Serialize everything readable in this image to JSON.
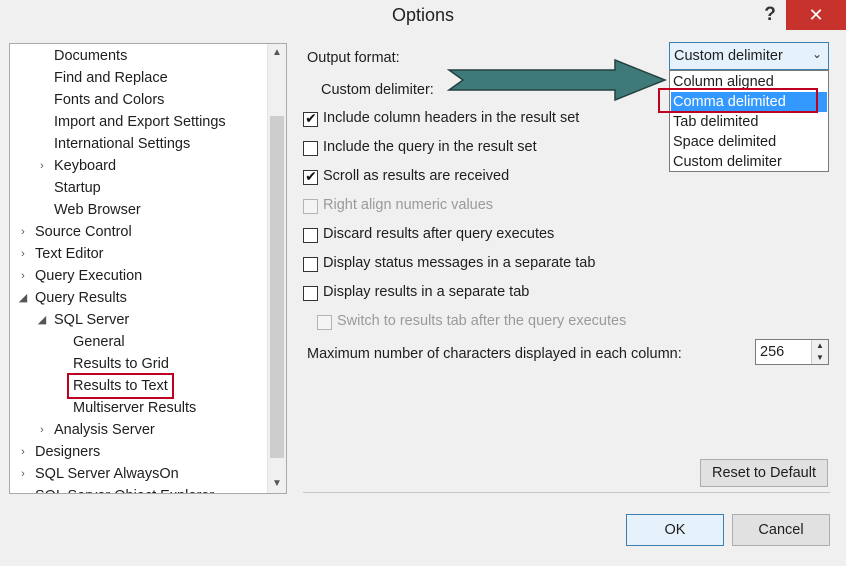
{
  "window": {
    "title": "Options",
    "help_glyph": "?",
    "close_glyph": "✕"
  },
  "tree": {
    "items": [
      {
        "label": "Documents",
        "arrow": ""
      },
      {
        "label": "Find and Replace",
        "arrow": ""
      },
      {
        "label": "Fonts and Colors",
        "arrow": ""
      },
      {
        "label": "Import and Export Settings",
        "arrow": ""
      },
      {
        "label": "International Settings",
        "arrow": ""
      },
      {
        "label": "Keyboard",
        "arrow": "›"
      },
      {
        "label": "Startup",
        "arrow": ""
      },
      {
        "label": "Web Browser",
        "arrow": ""
      },
      {
        "label": "Source Control",
        "arrow": "›"
      },
      {
        "label": "Text Editor",
        "arrow": "›"
      },
      {
        "label": "Query Execution",
        "arrow": "›"
      },
      {
        "label": "Query Results",
        "arrow": "◢"
      },
      {
        "label": "SQL Server",
        "arrow": "◢"
      },
      {
        "label": "General",
        "arrow": ""
      },
      {
        "label": "Results to Grid",
        "arrow": ""
      },
      {
        "label": "Results to Text",
        "arrow": ""
      },
      {
        "label": "Multiserver Results",
        "arrow": ""
      },
      {
        "label": "Analysis Server",
        "arrow": "›"
      },
      {
        "label": "Designers",
        "arrow": "›"
      },
      {
        "label": "SQL Server AlwaysOn",
        "arrow": "›"
      },
      {
        "label": "SQL Server Object Explorer",
        "arrow": "›"
      }
    ],
    "selected": "Results to Text"
  },
  "settings": {
    "output_format_label": "Output format:",
    "custom_delimiter_label": "Custom delimiter:",
    "output_format_value": "Custom delimiter",
    "dropdown_options": [
      "Column aligned",
      "Comma delimited",
      "Tab delimited",
      "Space delimited",
      "Custom delimiter"
    ],
    "highlighted_option": "Comma delimited",
    "checkboxes": [
      {
        "label": "Include column headers in the result set",
        "checked": true,
        "enabled": true
      },
      {
        "label": "Include the query in the result set",
        "checked": false,
        "enabled": true
      },
      {
        "label": "Scroll as results are received",
        "checked": true,
        "enabled": true
      },
      {
        "label": "Right align numeric values",
        "checked": false,
        "enabled": false
      },
      {
        "label": "Discard results after query executes",
        "checked": false,
        "enabled": true
      },
      {
        "label": "Display status messages in a separate tab",
        "checked": false,
        "enabled": true
      },
      {
        "label": "Display results in a separate tab",
        "checked": false,
        "enabled": true
      },
      {
        "label": "Switch to results tab after the query executes",
        "checked": false,
        "enabled": false
      }
    ],
    "max_chars_label": "Maximum number of characters displayed in each column:",
    "max_chars_value": "256",
    "reset_label": "Reset to Default"
  },
  "buttons": {
    "ok": "OK",
    "cancel": "Cancel"
  },
  "colors": {
    "highlight": "#3399ff",
    "annotation_red": "#c00020",
    "arrow_fill": "#3f7a7a",
    "close": "#c7332c"
  }
}
